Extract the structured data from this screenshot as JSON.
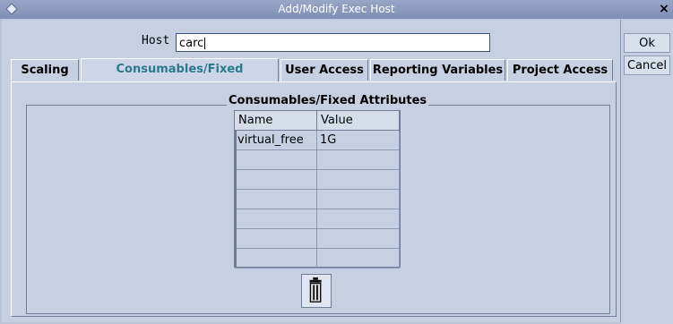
{
  "window": {
    "title": "Add/Modify Exec Host",
    "close_icon": "close-icon"
  },
  "host": {
    "label": "Host",
    "value": "carc"
  },
  "tabs": [
    {
      "label": "Scaling",
      "active": false
    },
    {
      "label": "Consumables/Fixed Attributes",
      "active": true
    },
    {
      "label": "User Access",
      "active": false
    },
    {
      "label": "Reporting Variables",
      "active": false
    },
    {
      "label": "Project Access",
      "active": false
    }
  ],
  "panel": {
    "group_title": "Consumables/Fixed Attributes",
    "table": {
      "columns": [
        "Name",
        "Value"
      ],
      "rows": [
        [
          "virtual_free",
          "1G"
        ],
        [
          "",
          ""
        ],
        [
          "",
          ""
        ],
        [
          "",
          ""
        ],
        [
          "",
          ""
        ],
        [
          "",
          ""
        ],
        [
          "",
          ""
        ]
      ]
    },
    "delete_icon": "trash-icon"
  },
  "buttons": {
    "ok": "Ok",
    "cancel": "Cancel"
  },
  "colors": {
    "active_tab": "#2b7a8c",
    "background": "#c6d0e3",
    "titlebar": "#8b9abd"
  }
}
